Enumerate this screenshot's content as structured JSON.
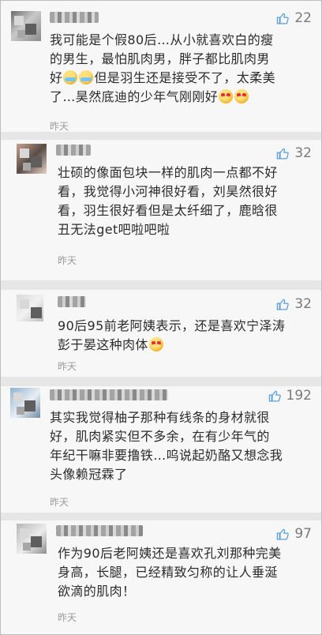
{
  "comments": [
    {
      "likes": "22",
      "lines": [
        "我可能是个假80后…从小就喜欢白的瘦",
        "的男生，最怕肌肉男，胖子都比肌肉男",
        "好|cry|cry|但是羽生还是接受不了，太柔美",
        "了…昊然底迪的少年气刚刚好|heart|heart"
      ],
      "time": "昨天"
    },
    {
      "likes": "32",
      "lines": [
        "壮硕的像面包块一样的肌肉一点都不好",
        "看，我觉得小河神很好看，刘昊然很好",
        "看，羽生很好看但是太纤细了，鹿晗很",
        "丑无法get吧啦吧啦"
      ],
      "time": "昨天"
    },
    {
      "likes": "32",
      "lines": [
        "90后95前老阿姨表示，还是喜欢宁泽涛",
        "彭于晏这种肉体|heart"
      ],
      "time": "昨天"
    },
    {
      "likes": "192",
      "lines": [
        "其实我觉得柚子那种有线条的身材就很",
        "好，肌肉紧实但不多余，在有少年气的",
        "年纪干嘛非要撸铁…呜说起奶酪又想念我",
        "头像赖冠霖了"
      ],
      "time": "昨天"
    },
    {
      "likes": "97",
      "lines": [
        "作为90后老阿姨还是喜欢孔刘那种完美",
        "身高，长腿，已经精致匀称的让人垂涎",
        "欲滴的肌肉！"
      ],
      "time": "昨天"
    }
  ],
  "colors": {
    "background": "#f7f7f7",
    "text": "#2b2b2b",
    "muted": "#9b9b9b",
    "like": "#7a7a7a"
  },
  "icons": {
    "like": "thumbs-up-icon",
    "emoji_laugh_cry": "laughing-crying-emoji-icon",
    "emoji_heart_eyes": "heart-eyes-emoji-icon"
  }
}
